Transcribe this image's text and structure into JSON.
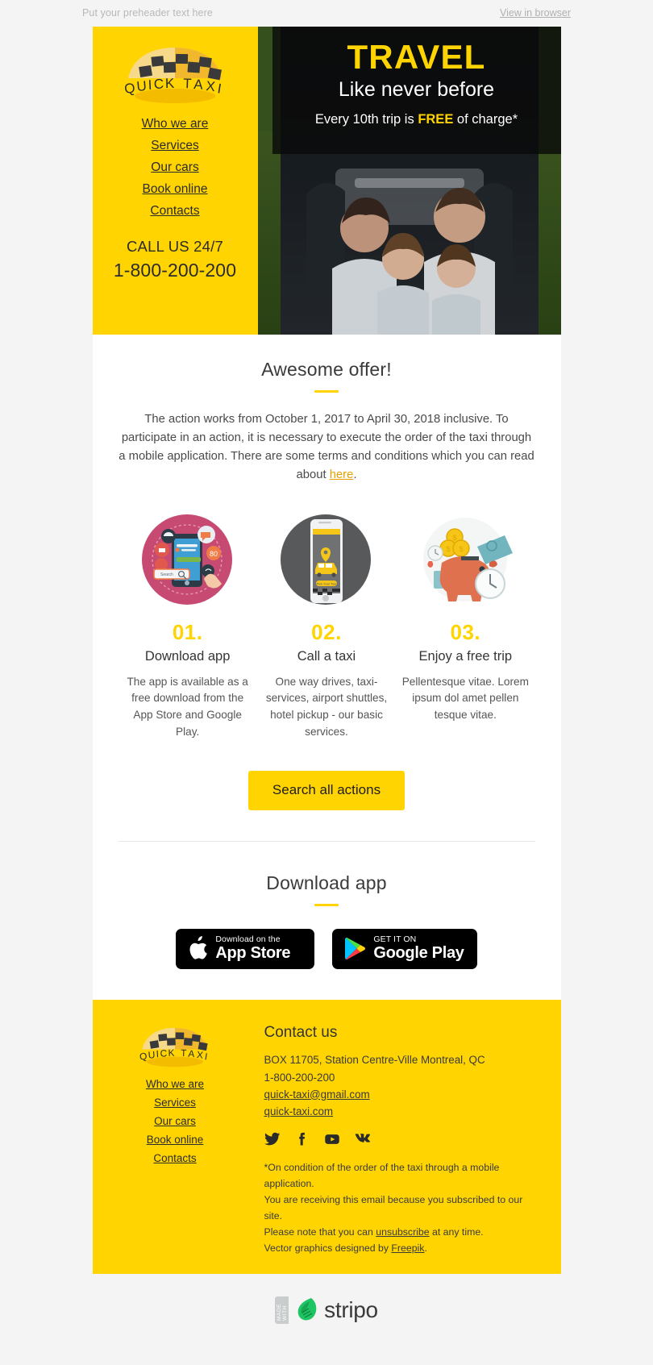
{
  "preheader": {
    "text": "Put your preheader text here",
    "view_in_browser": "View in browser"
  },
  "brand": {
    "name": "QUICK TAXI",
    "yellow": "#ffd400",
    "dark": "#2b2b2b"
  },
  "header": {
    "nav": [
      {
        "label": "Who we are"
      },
      {
        "label": "Services"
      },
      {
        "label": "Our cars"
      },
      {
        "label": "Book online"
      },
      {
        "label": "Contacts"
      }
    ],
    "call_label": "CALL US 24/7",
    "phone": "1-800-200-200"
  },
  "hero": {
    "title": "TRAVEL",
    "subtitle": "Like never before",
    "note_before": "Every 10th trip is ",
    "note_strong": "FREE",
    "note_after": " of charge*"
  },
  "offer": {
    "title": "Awesome offer!",
    "body_before": "The action works from October 1, 2017 to April 30, 2018 inclusive. To participate in an action, it is necessary to execute the order of the taxi through a mobile application. There are some terms and conditions which you can read about ",
    "body_link": "here",
    "body_after": "."
  },
  "features": [
    {
      "icon": "phone-search-app-icon",
      "number": "01.",
      "heading": "Download app",
      "text": "The app is available as a free download from the App Store and Google Play."
    },
    {
      "icon": "phone-taxi-app-icon",
      "number": "02.",
      "heading": "Call a taxi",
      "text": "One way drives, taxi-services, airport shuttles, hotel pickup - our basic services."
    },
    {
      "icon": "piggy-bank-savings-icon",
      "number": "03.",
      "heading": "Enjoy a free trip",
      "text": "Pellentesque vitae. Lorem ipsum dol amet pellen tesque vitae."
    }
  ],
  "cta": {
    "label": "Search all actions"
  },
  "download": {
    "title": "Download app",
    "badges": [
      {
        "icon": "apple-icon",
        "small": "Download on the",
        "big": "App Store"
      },
      {
        "icon": "google-play-icon",
        "small": "GET IT ON",
        "big": "Google Play"
      }
    ]
  },
  "footer": {
    "nav": [
      {
        "label": "Who we are"
      },
      {
        "label": "Services"
      },
      {
        "label": "Our cars"
      },
      {
        "label": "Book online"
      },
      {
        "label": "Contacts"
      }
    ],
    "contact_title": "Contact us",
    "address": "BOX 11705, Station Centre-Ville Montreal, QC",
    "phone": "1-800-200-200",
    "email": "quick-taxi@gmail.com",
    "website": "quick-taxi.com",
    "socials": [
      {
        "name": "twitter-icon"
      },
      {
        "name": "facebook-icon"
      },
      {
        "name": "youtube-icon"
      },
      {
        "name": "vk-icon"
      }
    ],
    "legal_line1": "*On condition of the order of the taxi through a mobile application.",
    "legal_line2": "You are receiving this email because you subscribed to our site.",
    "legal_line3_before": "Please note that you can ",
    "legal_line3_link": "unsubscribe",
    "legal_line3_after": " at any time.",
    "legal_line4_before": "Vector graphics designed by ",
    "legal_line4_link": "Freepik",
    "legal_line4_after": "."
  },
  "stripo": {
    "ribbon": "MADE WITH",
    "word": "stripo"
  }
}
